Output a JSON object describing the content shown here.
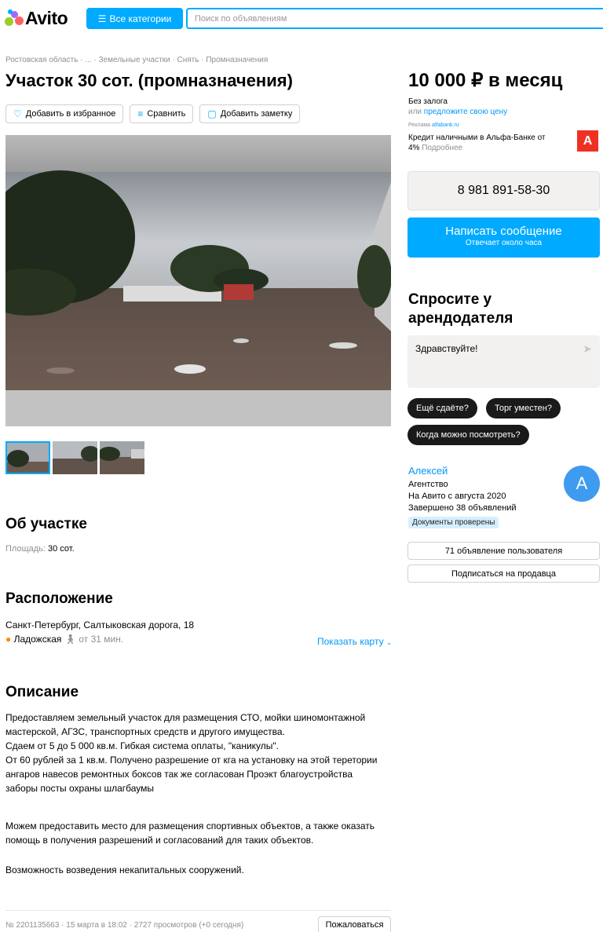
{
  "header": {
    "logo_text": "Avito",
    "categories_button": "Все категории",
    "search_placeholder": "Поиск по объявлениям"
  },
  "breadcrumb": "Ростовская область · ... · Земельные участки · Снять · Промназначения",
  "title": "Участок 30 сот. (промназначения)",
  "actions": {
    "favorite": "Добавить в избранное",
    "compare": "Сравнить",
    "note": "Добавить заметку"
  },
  "gallery": {
    "thumbnail_count": 3,
    "active_index": 0
  },
  "about": {
    "heading": "Об участке",
    "area_label": "Площадь:",
    "area_value": "30 сот."
  },
  "location": {
    "heading": "Расположение",
    "address": "Санкт-Петербург, Салтыковская дорога, 18",
    "metro": "Ладожская",
    "metro_time": "от 31 мин.",
    "show_map": "Показать карту",
    "metro_color": "#ff8a00"
  },
  "description": {
    "heading": "Описание",
    "lines": [
      "Предоставляем земельный участок для размещения СТО, мойки шиномонтажной",
      "мастерской, АГЗС, транспортных средств и другого имущества.",
      "Сдаем от 5 до 5 000 кв.м. Гибкая система оплаты, \"каникулы\".",
      "От 60 рублей за 1 кв.м. Получено разрешение от кга на установку на этой теретории",
      "ангаров навесов ремонтных боксов так же согласован Проэкт благоустройства",
      "заборы посты охраны шлагбаумы"
    ],
    "para2_lines": [
      "Можем предоставить место для размещения спортивных объектов, а также оказать",
      "помощь в получения разрешений и согласований для таких объектов."
    ],
    "para3": "Возможность возведения некапитальных сооружений."
  },
  "footer": {
    "meta": "№ 2201135663 · 15 марта в 18:02 · 2727 просмотров (+0 сегодня)",
    "report": "Пожаловаться"
  },
  "sidebar": {
    "price": "10 000 ₽ в месяц",
    "deposit": "Без залога",
    "offer_prefix": "или",
    "offer_link": "предложите свою цену",
    "ad_label": "Реклама",
    "ad_domain": "alfabank.ru",
    "ad_text_1": "Кредит наличными в Альфа-Банке от",
    "ad_text_2": "4%",
    "ad_more": "Подробнее",
    "ad_logo": "А",
    "phone": "8 981 891-58-30",
    "message_button": "Написать сообщение",
    "message_sub": "Отвечает около часа",
    "ask_heading": "Спросите у арендодателя",
    "ask_text": "Здравствуйте!",
    "chips": [
      "Ещё сдаёте?",
      "Торг уместен?",
      "Когда можно посмотреть?"
    ],
    "seller_name": "Алексей",
    "seller_type": "Агентство",
    "seller_since": "На Авито с августа 2020",
    "seller_done": "Завершено 38 объявлений",
    "seller_badge": "Документы проверены",
    "avatar_letter": "А",
    "user_ads": "71 объявление пользователя",
    "subscribe": "Подписаться на продавца"
  },
  "colors": {
    "accent": "#00aaff",
    "link": "#0099f7",
    "avatar": "#3e9bf0",
    "alfa_red": "#ef3124"
  }
}
